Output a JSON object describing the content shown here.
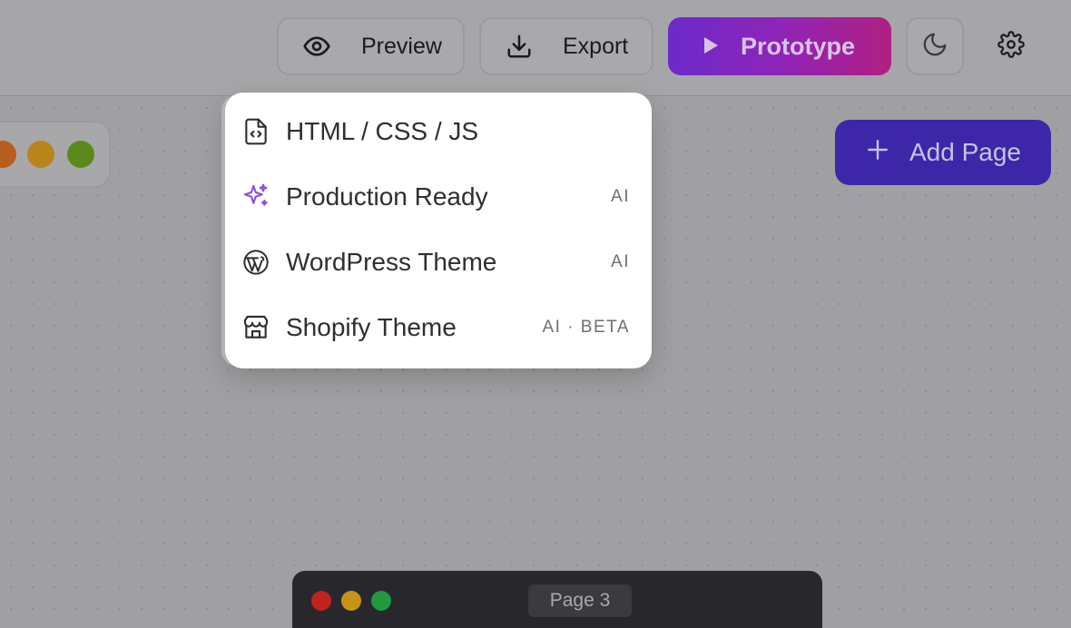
{
  "toolbar": {
    "preview_label": "Preview",
    "export_label": "Export",
    "prototype_label": "Prototype",
    "icons": {
      "preview": "eye-icon",
      "export": "download-icon",
      "prototype": "play-icon",
      "theme": "moon-icon",
      "settings": "gear-icon"
    }
  },
  "canvas": {
    "add_page_label": "Add Page",
    "window_controls": [
      "close",
      "minimize",
      "maximize"
    ]
  },
  "export_menu": {
    "items": [
      {
        "label": "HTML / CSS / JS",
        "tag": "",
        "icon": "code-file-icon"
      },
      {
        "label": "Production Ready",
        "tag": "AI",
        "icon": "sparkles-icon"
      },
      {
        "label": "WordPress Theme",
        "tag": "AI",
        "icon": "wordpress-icon"
      },
      {
        "label": "Shopify Theme",
        "tag": "AI · BETA",
        "icon": "storefront-icon"
      }
    ]
  },
  "page_frame": {
    "page_label": "Page 3"
  },
  "colors": {
    "prototype_gradient": [
      "#6b2bc9",
      "#b01f82"
    ],
    "add_page_bg": "#3d27a8",
    "sparkle_accent": "#8a4fe0"
  }
}
